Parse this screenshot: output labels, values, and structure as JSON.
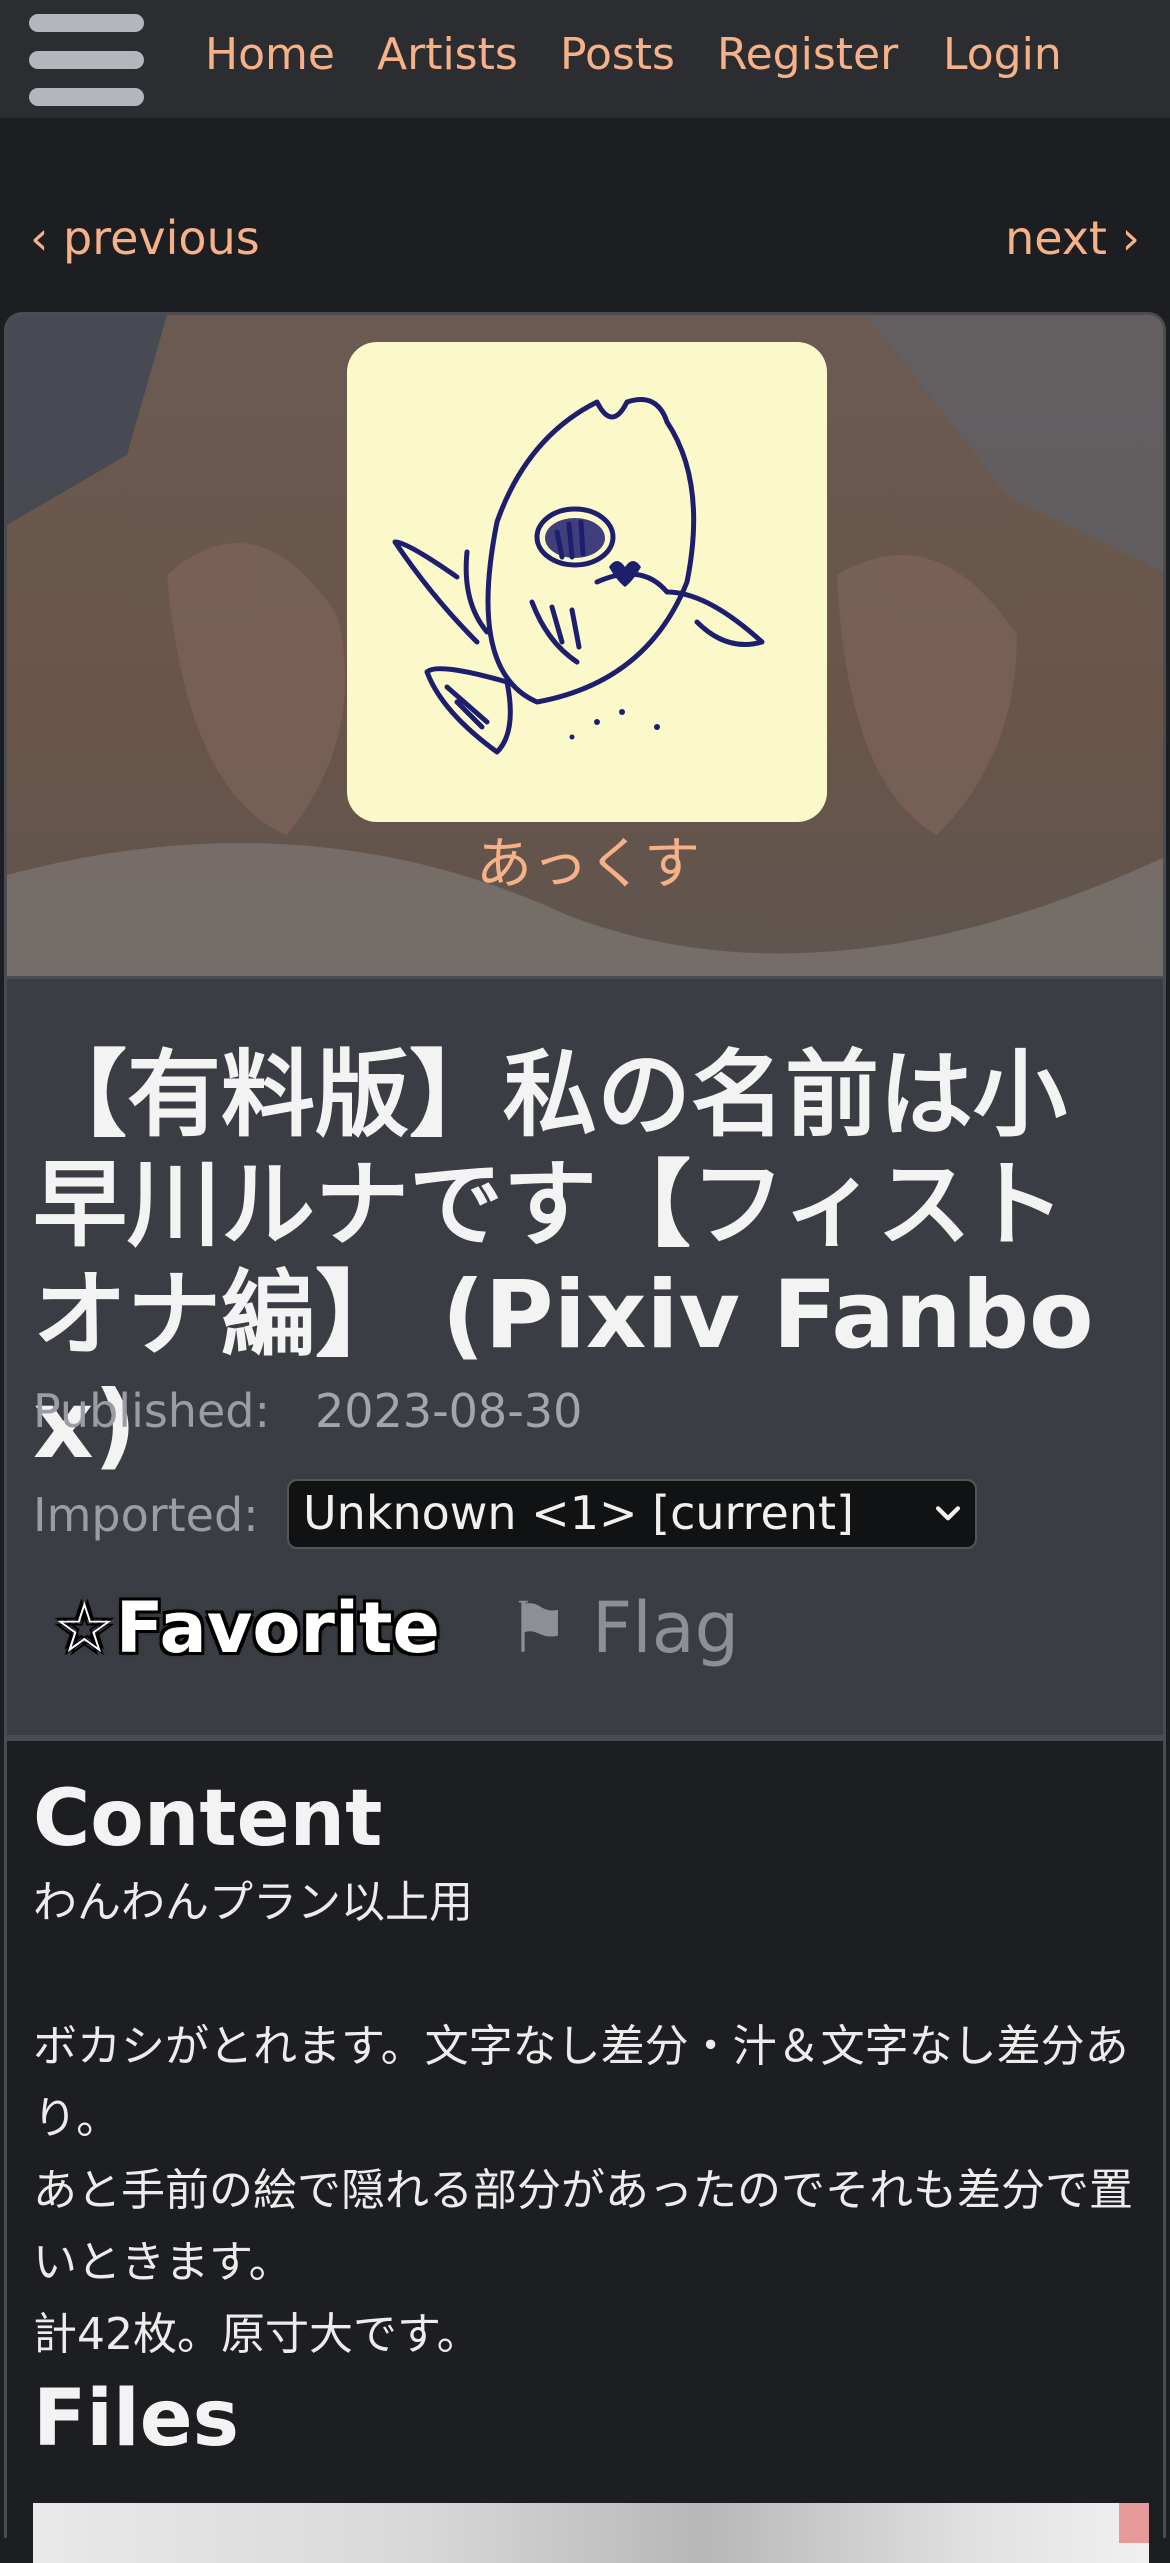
{
  "nav": {
    "links": [
      "Home",
      "Artists",
      "Posts",
      "Register",
      "Login"
    ]
  },
  "pager": {
    "previous": "‹ previous",
    "next": "next ›"
  },
  "artist": {
    "name": "あっくす"
  },
  "post": {
    "title": "【有料版】私の名前は小早川ルナです【フィストオナ編】 (Pixiv Fanbox)",
    "published_label": "Published:",
    "published_value": "2023-08-30",
    "imported_label": "Imported:",
    "imported_selected": "Unknown <1> [current]",
    "favorite_label": "☆Favorite",
    "flag_label": "⚑ Flag"
  },
  "content": {
    "heading": "Content",
    "paragraphs": [
      "わんわんプラン以上用",
      "",
      "ボカシがとれます。文字なし差分・汁＆文字なし差分あり。",
      "あと手前の絵で隠れる部分があったのでそれも差分で置いときます。",
      "計42枚。原寸大です。"
    ],
    "files_heading": "Files"
  },
  "colors": {
    "accent": "#f6b188",
    "navbar": "#2c2d31",
    "info_panel": "#3b3d44",
    "page_bg": "#1d1e21"
  }
}
